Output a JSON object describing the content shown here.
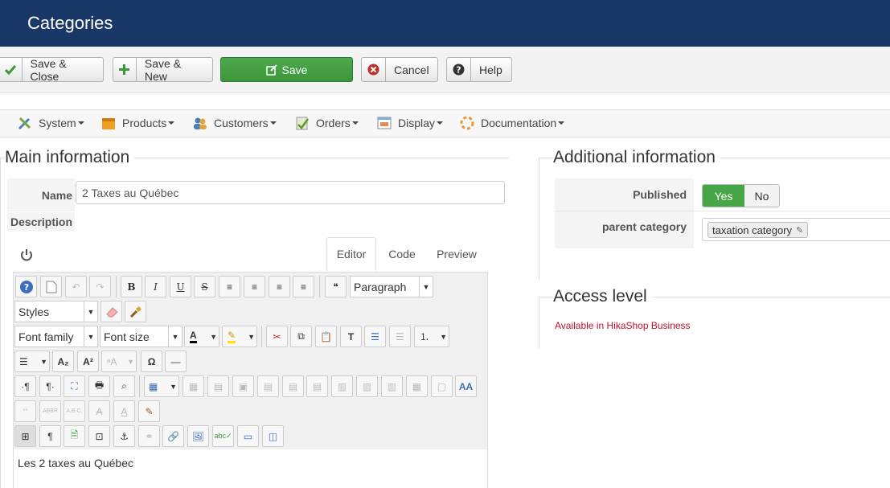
{
  "header": {
    "title": "Categories"
  },
  "toolbar": {
    "save_close": "Save & Close",
    "save_new": "Save & New",
    "save": "Save",
    "cancel": "Cancel",
    "help": "Help"
  },
  "menu": {
    "system": "System",
    "products": "Products",
    "customers": "Customers",
    "orders": "Orders",
    "display": "Display",
    "documentation": "Documentation"
  },
  "main": {
    "legend": "Main information",
    "name_label": "Name",
    "name_value": "2 Taxes au Québec",
    "description_label": "Description"
  },
  "editor": {
    "tabs": [
      "Editor",
      "Code",
      "Preview"
    ],
    "format_select": "Paragraph",
    "styles_select": "Styles",
    "font_family_select": "Font family",
    "font_size_select": "Font size",
    "content": "Les 2 taxes au Québec"
  },
  "additional": {
    "legend": "Additional information",
    "published_label": "Published",
    "yes": "Yes",
    "no": "No",
    "parent_label": "parent category",
    "parent_value": "taxation category"
  },
  "access": {
    "legend": "Access level",
    "notice": "Available in HikaShop Business"
  },
  "colors": {
    "header": "#1a3867",
    "save_green": "#46a546",
    "notice_red": "#c0102a"
  }
}
